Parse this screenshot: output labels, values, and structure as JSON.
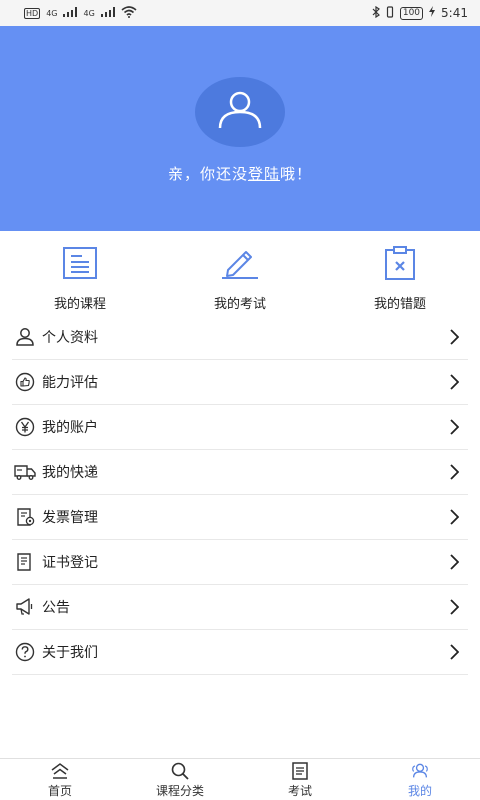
{
  "status_bar": {
    "hd1": "HD",
    "net1": "4G",
    "net2": "4G",
    "battery": "100",
    "time": "5:41"
  },
  "header": {
    "login_prefix": "亲，你还没",
    "login_link": "登陆",
    "login_suffix": "哦！",
    "accent": "#6590f3"
  },
  "quick_entries": [
    {
      "label": "我的课程",
      "icon": "course-icon"
    },
    {
      "label": "我的考试",
      "icon": "exam-pencil-icon"
    },
    {
      "label": "我的错题",
      "icon": "wrong-questions-icon"
    }
  ],
  "menu": [
    {
      "label": "个人资料",
      "icon": "user-icon"
    },
    {
      "label": "能力评估",
      "icon": "thumb-up-icon"
    },
    {
      "label": "我的账户",
      "icon": "yen-icon"
    },
    {
      "label": "我的快递",
      "icon": "truck-icon"
    },
    {
      "label": "发票管理",
      "icon": "invoice-icon"
    },
    {
      "label": "证书登记",
      "icon": "certificate-icon"
    },
    {
      "label": "公告",
      "icon": "megaphone-icon"
    },
    {
      "label": "关于我们",
      "icon": "question-icon"
    }
  ],
  "tabs": [
    {
      "label": "首页",
      "icon": "home-icon",
      "active": false
    },
    {
      "label": "课程分类",
      "icon": "search-icon",
      "active": false
    },
    {
      "label": "考试",
      "icon": "exam-doc-icon",
      "active": false
    },
    {
      "label": "我的",
      "icon": "people-icon",
      "active": true
    }
  ],
  "colors": {
    "tab_active": "#5b86e5",
    "icon_blue": "#5b86e5"
  }
}
